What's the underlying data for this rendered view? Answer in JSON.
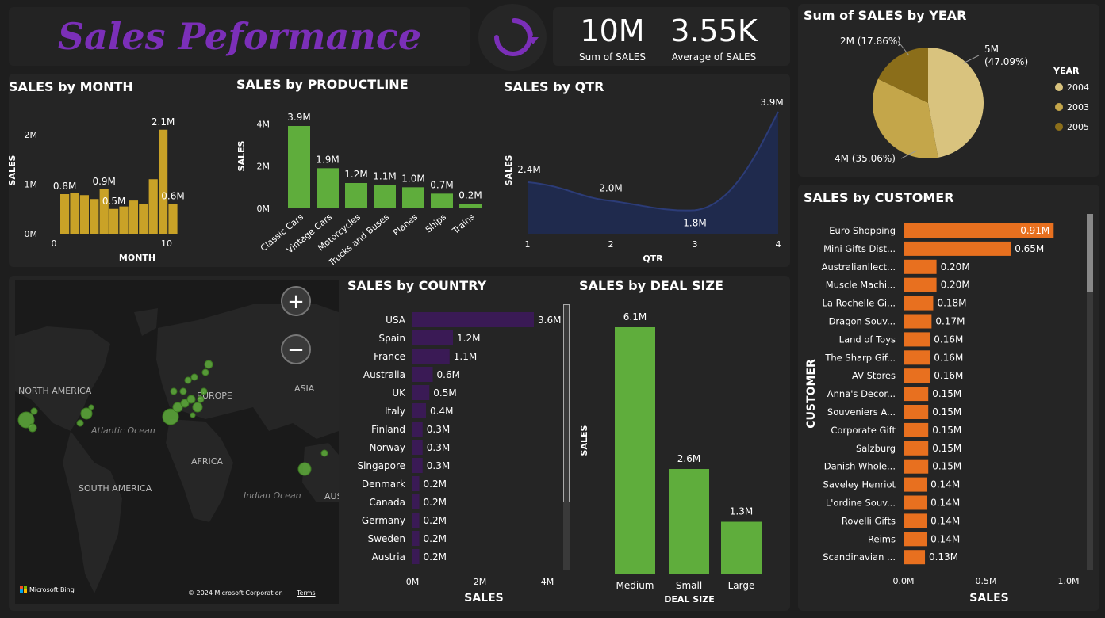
{
  "title": "Sales Peformance",
  "refresh_icon": "refresh-icon",
  "kpis": [
    {
      "value": "10M",
      "label": "Sum of SALES"
    },
    {
      "value": "3.55K",
      "label": "Average of SALES"
    }
  ],
  "colors": {
    "gold": "#c9a227",
    "green": "#5fad3c",
    "purple": "#3a1a55",
    "orange": "#e8701f",
    "navy": "#1f2a4d",
    "title_purple": "#7b2fb8"
  },
  "map": {
    "labels": [
      "NORTH AMERICA",
      "EUROPE",
      "ASIA",
      "Atlantic Ocean",
      "AFRICA",
      "SOUTH AMERICA",
      "Indian Ocean",
      "AUS"
    ],
    "attribution_brand": "Microsoft Bing",
    "copyright": "© 2024 Microsoft Corporation",
    "terms": "Terms",
    "zoom_in": "+",
    "zoom_out": "−"
  },
  "chart_data": [
    {
      "id": "month",
      "type": "bar",
      "title": "SALES by MONTH",
      "xlabel": "MONTH",
      "ylabel": "SALES",
      "x": [
        1,
        2,
        3,
        4,
        5,
        6,
        7,
        8,
        9,
        10,
        11,
        12
      ],
      "values": [
        0.8,
        0.82,
        0.78,
        0.7,
        0.9,
        0.5,
        0.55,
        0.67,
        0.6,
        1.1,
        2.1,
        0.6
      ],
      "data_labels": {
        "1": "0.8M",
        "5": "0.9M",
        "6": "0.5M",
        "11": "2.1M",
        "12": "0.6M"
      },
      "yticks": [
        "0M",
        "1M",
        "2M"
      ],
      "xticks": [
        "0",
        "10"
      ],
      "ylim": [
        0,
        2.4
      ],
      "color": "#c9a227"
    },
    {
      "id": "productline",
      "type": "bar",
      "title": "SALES by PRODUCTLINE",
      "ylabel": "SALES",
      "categories": [
        "Classic Cars",
        "Vintage Cars",
        "Motorcycles",
        "Trucks and Buses",
        "Planes",
        "Ships",
        "Trains"
      ],
      "values": [
        3.9,
        1.9,
        1.2,
        1.1,
        1.0,
        0.7,
        0.2
      ],
      "value_labels": [
        "3.9M",
        "1.9M",
        "1.2M",
        "1.1M",
        "1.0M",
        "0.7M",
        "0.2M"
      ],
      "yticks": [
        "0M",
        "2M",
        "4M"
      ],
      "ylim": [
        0,
        4.2
      ],
      "color": "#5fad3c"
    },
    {
      "id": "qtr",
      "type": "area",
      "title": "SALES by QTR",
      "xlabel": "QTR",
      "ylabel": "SALES",
      "x": [
        1,
        2,
        3,
        4
      ],
      "values": [
        2.4,
        2.0,
        1.8,
        3.9
      ],
      "value_labels": [
        "2.4M",
        "2.0M",
        "1.8M",
        "3.9M"
      ],
      "ylim": [
        1.3,
        3.9
      ],
      "color": "#1f2a4d"
    },
    {
      "id": "year",
      "type": "pie",
      "title": "Sum of SALES by YEAR",
      "legend_title": "YEAR",
      "categories": [
        "2004",
        "2003",
        "2005"
      ],
      "values": [
        47.09,
        35.06,
        17.86
      ],
      "slice_labels": [
        "5M\n(47.09%)",
        "4M (35.06%)",
        "2M (17.86%)"
      ],
      "colors": [
        "#d9c37e",
        "#c4a64a",
        "#8b6e1a"
      ]
    },
    {
      "id": "country",
      "type": "bar",
      "orientation": "horizontal",
      "title": "SALES by COUNTRY",
      "xlabel": "SALES",
      "categories": [
        "USA",
        "Spain",
        "France",
        "Australia",
        "UK",
        "Italy",
        "Finland",
        "Norway",
        "Singapore",
        "Denmark",
        "Canada",
        "Germany",
        "Sweden",
        "Austria"
      ],
      "values": [
        3.6,
        1.2,
        1.1,
        0.6,
        0.5,
        0.4,
        0.3,
        0.3,
        0.3,
        0.2,
        0.2,
        0.2,
        0.2,
        0.2
      ],
      "value_labels": [
        "3.6M",
        "1.2M",
        "1.1M",
        "0.6M",
        "0.5M",
        "0.4M",
        "0.3M",
        "0.3M",
        "0.3M",
        "0.2M",
        "0.2M",
        "0.2M",
        "0.2M",
        "0.2M"
      ],
      "xticks": [
        "0M",
        "2M",
        "4M"
      ],
      "xlim": [
        0,
        4
      ],
      "color": "#3a1a55"
    },
    {
      "id": "dealsize",
      "type": "bar",
      "title": "SALES by DEAL SIZE",
      "xlabel": "DEAL SIZE",
      "ylabel": "SALES",
      "categories": [
        "Medium",
        "Small",
        "Large"
      ],
      "values": [
        6.1,
        2.6,
        1.3
      ],
      "value_labels": [
        "6.1M",
        "2.6M",
        "1.3M"
      ],
      "ylim": [
        0,
        6.1
      ],
      "color": "#5fad3c"
    },
    {
      "id": "customer",
      "type": "bar",
      "orientation": "horizontal",
      "title": "SALES by CUSTOMER",
      "xlabel": "SALES",
      "ylabel": "CUSTOMER",
      "categories": [
        "Euro Shopping",
        "Mini Gifts Dist...",
        "Australianllect...",
        "Muscle Machi...",
        "La Rochelle Gi...",
        "Dragon Souv...",
        "Land of Toys",
        "The Sharp Gif...",
        "AV Stores",
        "Anna's Decor...",
        "Souveniers A...",
        "Corporate Gift",
        "Salzburg",
        "Danish Whole...",
        "Saveley Henriot",
        "L'ordine Souv...",
        "Rovelli Gifts",
        "Reims",
        "Scandinavian ..."
      ],
      "values": [
        0.91,
        0.65,
        0.2,
        0.2,
        0.18,
        0.17,
        0.16,
        0.16,
        0.16,
        0.15,
        0.15,
        0.15,
        0.15,
        0.15,
        0.14,
        0.14,
        0.14,
        0.14,
        0.13
      ],
      "value_labels": [
        "0.91M",
        "0.65M",
        "0.20M",
        "0.20M",
        "0.18M",
        "0.17M",
        "0.16M",
        "0.16M",
        "0.16M",
        "0.15M",
        "0.15M",
        "0.15M",
        "0.15M",
        "0.15M",
        "0.14M",
        "0.14M",
        "0.14M",
        "0.14M",
        "0.13M"
      ],
      "xticks": [
        "0.0M",
        "0.5M",
        "1.0M"
      ],
      "xlim": [
        0,
        1.0
      ],
      "color": "#e8701f"
    }
  ]
}
